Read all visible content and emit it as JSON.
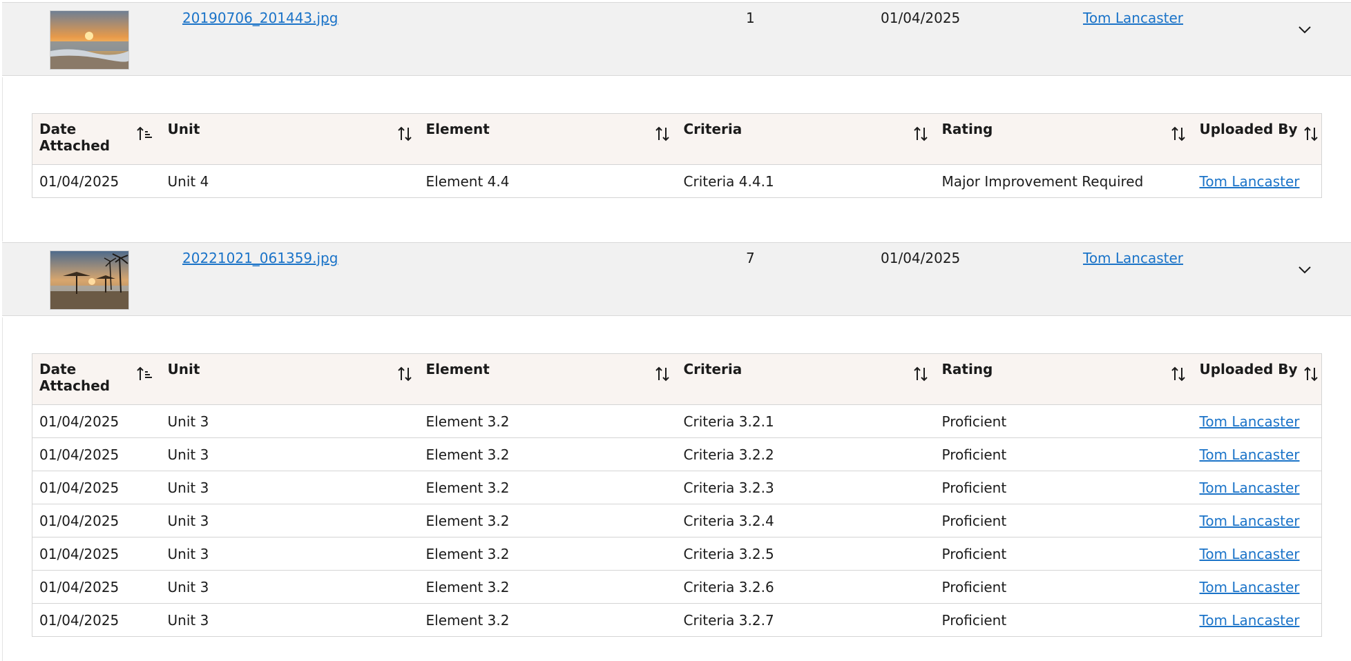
{
  "attachments": [
    {
      "filename": "20190706_201443.jpg",
      "thumb_icon": "sunset-beach-thumbnail",
      "count": "1",
      "date": "01/04/2025",
      "uploaded_by": "Tom Lancaster",
      "rows": [
        {
          "date": "01/04/2025",
          "unit": "Unit 4",
          "element": "Element 4.4",
          "criteria": "Criteria 4.4.1",
          "rating": "Major Improvement Required",
          "uploaded_by": "Tom Lancaster"
        }
      ]
    },
    {
      "filename": "20221021_061359.jpg",
      "thumb_icon": "beach-umbrellas-thumbnail",
      "count": "7",
      "date": "01/04/2025",
      "uploaded_by": "Tom Lancaster",
      "rows": [
        {
          "date": "01/04/2025",
          "unit": "Unit 3",
          "element": "Element 3.2",
          "criteria": "Criteria 3.2.1",
          "rating": "Proficient",
          "uploaded_by": "Tom Lancaster"
        },
        {
          "date": "01/04/2025",
          "unit": "Unit 3",
          "element": "Element 3.2",
          "criteria": "Criteria 3.2.2",
          "rating": "Proficient",
          "uploaded_by": "Tom Lancaster"
        },
        {
          "date": "01/04/2025",
          "unit": "Unit 3",
          "element": "Element 3.2",
          "criteria": "Criteria 3.2.3",
          "rating": "Proficient",
          "uploaded_by": "Tom Lancaster"
        },
        {
          "date": "01/04/2025",
          "unit": "Unit 3",
          "element": "Element 3.2",
          "criteria": "Criteria 3.2.4",
          "rating": "Proficient",
          "uploaded_by": "Tom Lancaster"
        },
        {
          "date": "01/04/2025",
          "unit": "Unit 3",
          "element": "Element 3.2",
          "criteria": "Criteria 3.2.5",
          "rating": "Proficient",
          "uploaded_by": "Tom Lancaster"
        },
        {
          "date": "01/04/2025",
          "unit": "Unit 3",
          "element": "Element 3.2",
          "criteria": "Criteria 3.2.6",
          "rating": "Proficient",
          "uploaded_by": "Tom Lancaster"
        },
        {
          "date": "01/04/2025",
          "unit": "Unit 3",
          "element": "Element 3.2",
          "criteria": "Criteria 3.2.7",
          "rating": "Proficient",
          "uploaded_by": "Tom Lancaster"
        }
      ]
    }
  ],
  "columns": {
    "date_attached": "Date Attached",
    "unit": "Unit",
    "element": "Element",
    "criteria": "Criteria",
    "rating": "Rating",
    "uploaded_by": "Uploaded By"
  },
  "icons": {
    "expand": "chevron-down-icon",
    "sort": "sort-icon",
    "sort_active": "sort-ascending-icon"
  },
  "colors": {
    "link": "#1a73c8",
    "file_row_bg": "#f1f1f1",
    "table_header_bg": "#f9f4f1"
  }
}
